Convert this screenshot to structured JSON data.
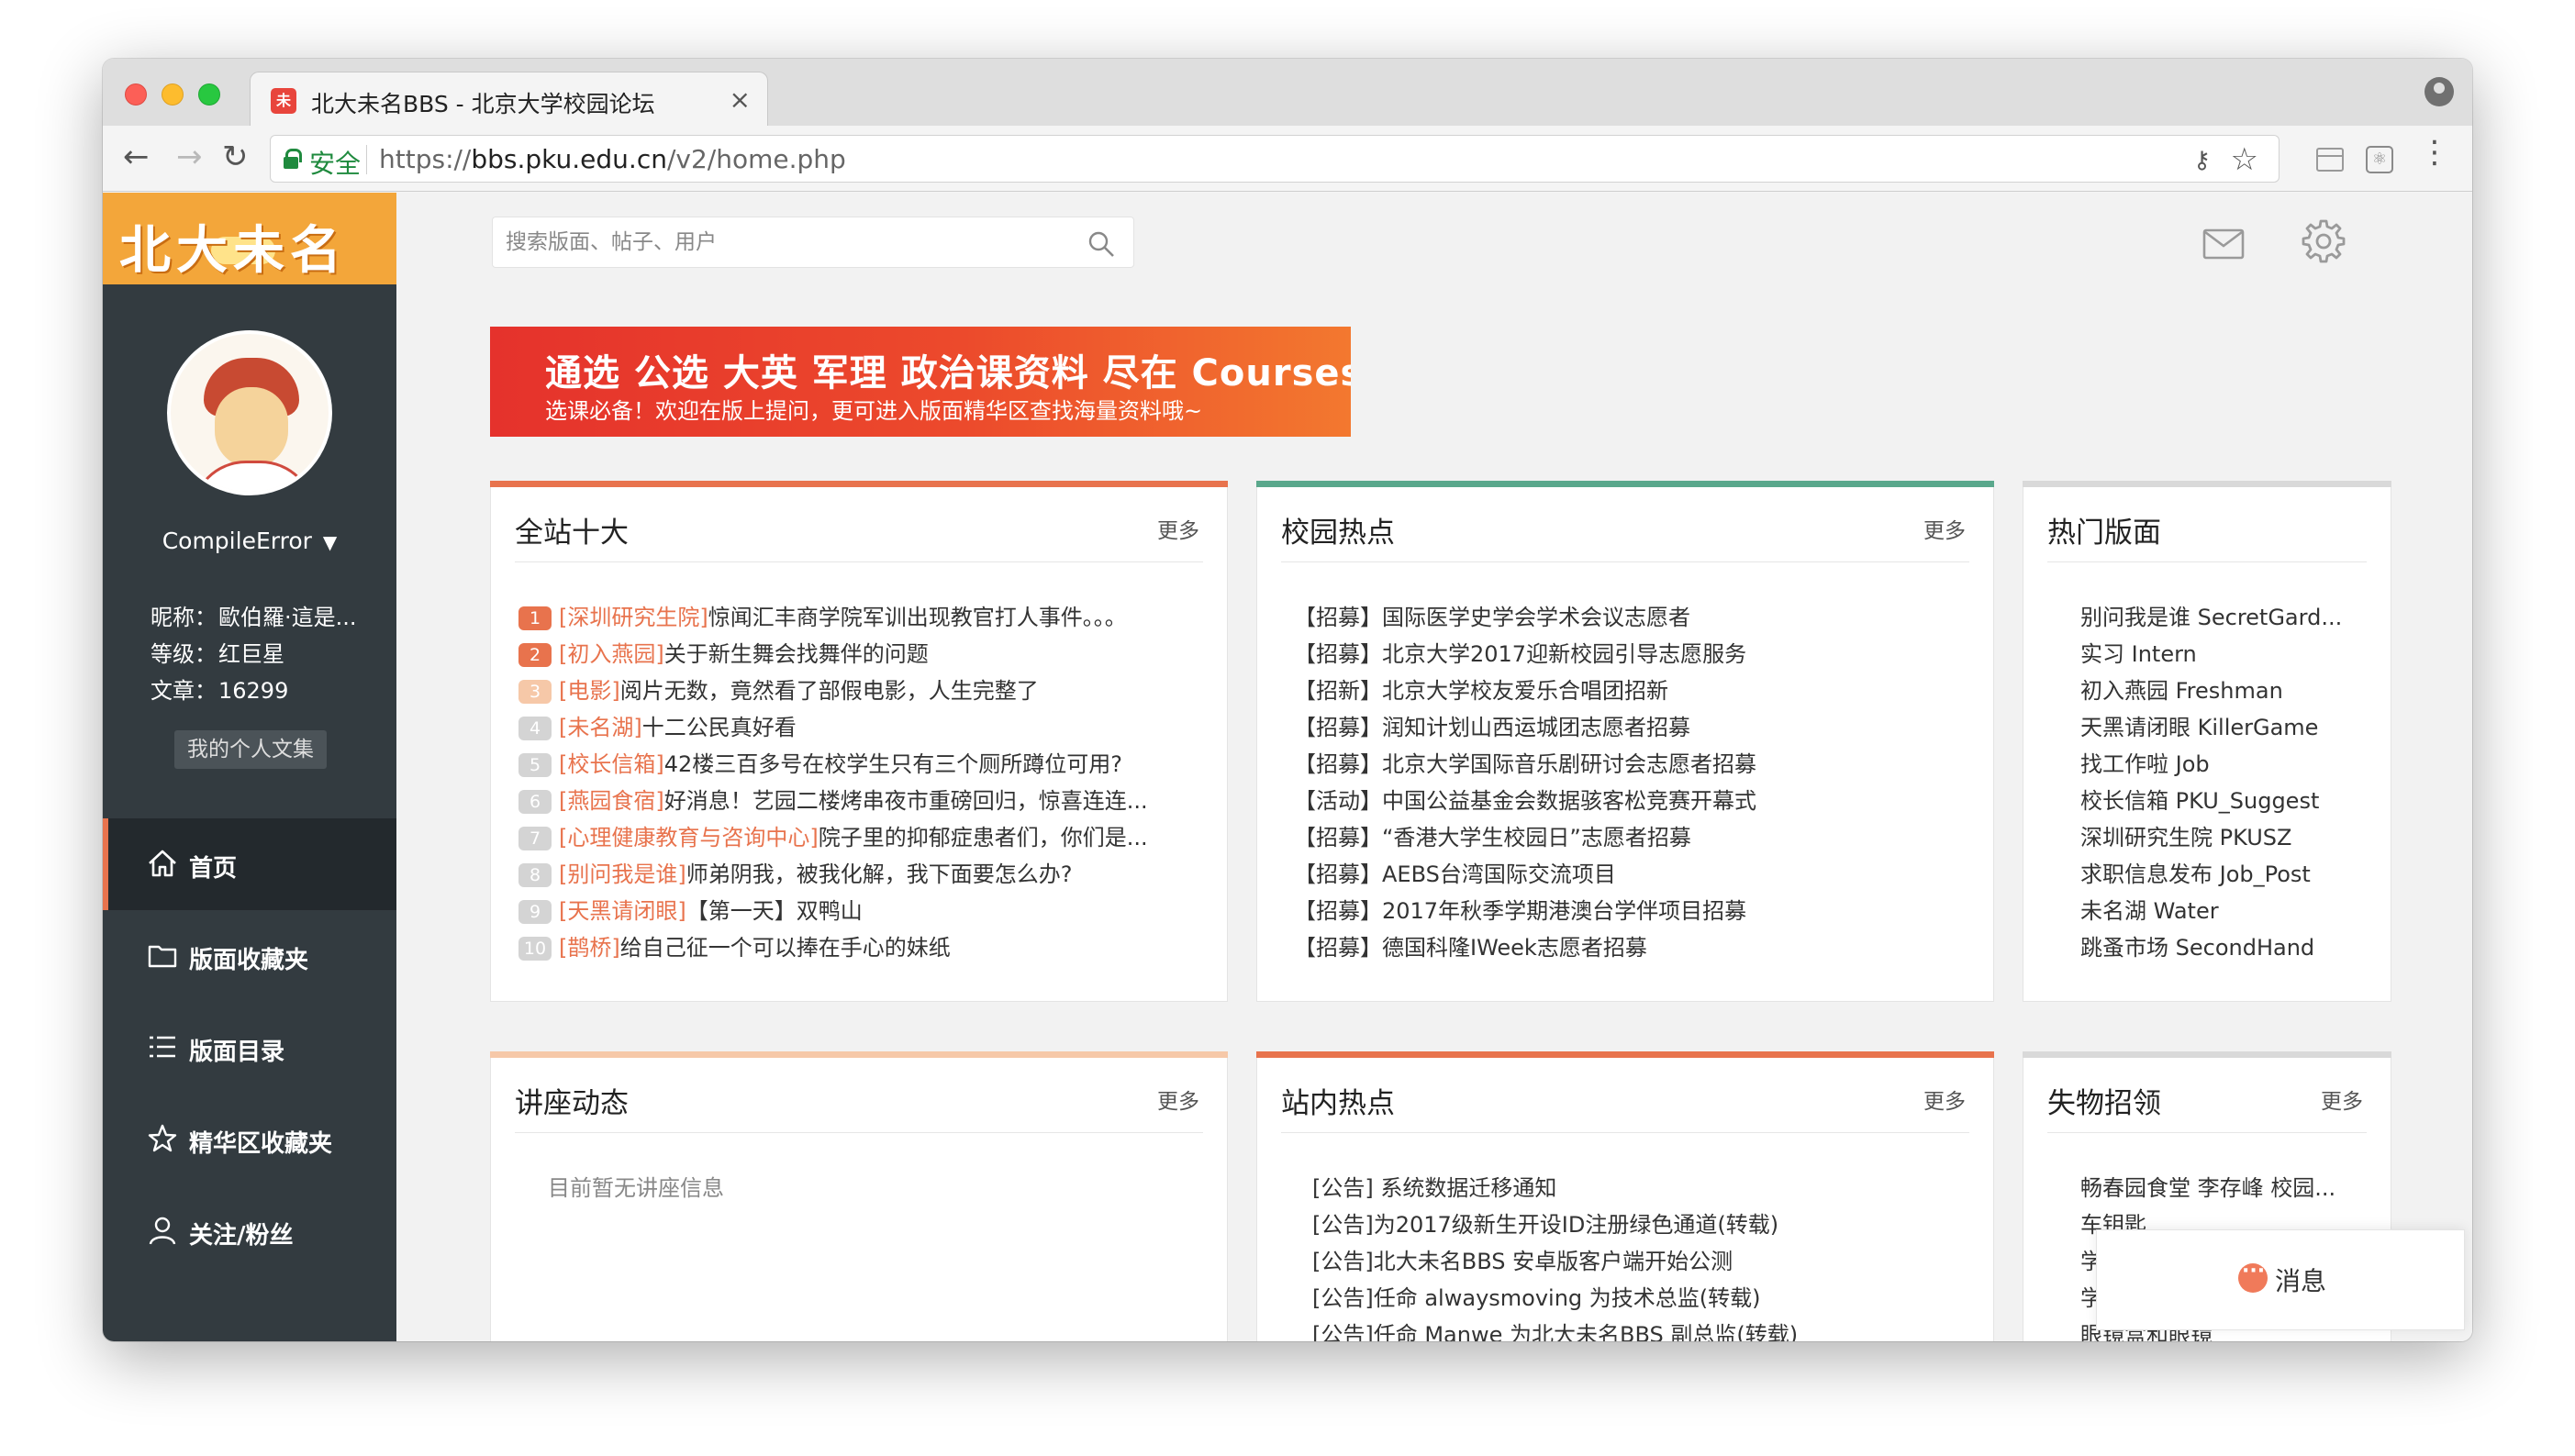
{
  "browser": {
    "tab_title": "北大未名BBS - 北京大学校园论坛",
    "tab_favicon": "未",
    "tab_close": "×",
    "secure_label": "安全",
    "url_prefix": "https://",
    "url_host": "bbs.pku.edu.cn",
    "url_path": "/v2/home.php"
  },
  "sidebar": {
    "logo": "北大未名",
    "username": "CompileError",
    "nickname_label": "昵称：",
    "nickname": "歐伯羅·這是...",
    "level_label": "等级：",
    "level": "红巨星",
    "posts_label": "文章：",
    "posts": "16299",
    "my_collection": "我的个人文集",
    "nav": [
      {
        "label": "首页",
        "icon": "home-icon"
      },
      {
        "label": "版面收藏夹",
        "icon": "folder-icon"
      },
      {
        "label": "版面目录",
        "icon": "list-icon"
      },
      {
        "label": "精华区收藏夹",
        "icon": "star-icon"
      },
      {
        "label": "关注/粉丝",
        "icon": "person-icon"
      }
    ]
  },
  "header": {
    "search_placeholder": "搜索版面、帖子、用户"
  },
  "banner": {
    "title": "通选 公选 大英 军理 政治课资料 尽在 Courses 版",
    "subtitle": "选课必备！欢迎在版上提问，更可进入版面精华区查找海量资料哦~"
  },
  "top10": {
    "title": "全站十大",
    "more": "更多",
    "color": "#e8734d",
    "items": [
      {
        "n": "1",
        "board": "[深圳研究生院]",
        "text": "惊闻汇丰商学院军训出现教官打人事件。。。"
      },
      {
        "n": "2",
        "board": "[初入燕园]",
        "text": "关于新生舞会找舞伴的问题"
      },
      {
        "n": "3",
        "board": "[电影]",
        "text": "阅片无数，竟然看了部假电影，人生完整了"
      },
      {
        "n": "4",
        "board": "[未名湖]",
        "text": "十二公民真好看"
      },
      {
        "n": "5",
        "board": "[校长信箱]",
        "text": "42楼三百多号在校学生只有三个厕所蹲位可用?"
      },
      {
        "n": "6",
        "board": "[燕园食宿]",
        "text": "好消息！艺园二楼烤串夜市重磅回归，惊喜连连..."
      },
      {
        "n": "7",
        "board": "[心理健康教育与咨询中心]",
        "text": "院子里的抑郁症患者们，你们是..."
      },
      {
        "n": "8",
        "board": "[别问我是谁]",
        "text": "师弟阴我，被我化解，我下面要怎么办?"
      },
      {
        "n": "9",
        "board": "[天黑请闭眼]",
        "text": "【第一天】双鸭山"
      },
      {
        "n": "10",
        "board": "[鹊桥]",
        "text": "给自己征一个可以捧在手心的妹纸"
      }
    ]
  },
  "campus": {
    "title": "校园热点",
    "more": "更多",
    "color": "#5aa88c",
    "items": [
      "【招募】国际医学史学会学术会议志愿者",
      "【招募】北京大学2017迎新校园引导志愿服务",
      "【招新】北京大学校友爱乐合唱团招新",
      "【招募】润知计划山西运城团志愿者招募",
      "【招募】北京大学国际音乐剧研讨会志愿者招募",
      "【活动】中国公益基金会数据骇客松竞赛开幕式",
      "【招募】“香港大学生校园日”志愿者招募",
      "【招募】AEBS台湾国际交流项目",
      "【招募】2017年秋季学期港澳台学伴项目招募",
      "【招募】德国科隆IWeek志愿者招募"
    ]
  },
  "hotboards": {
    "title": "热门版面",
    "color": "#d9d9d9",
    "items": [
      "别问我是谁 SecretGard...",
      "实习 Intern",
      "初入燕园 Freshman",
      "天黑请闭眼 KillerGame",
      "找工作啦 Job",
      "校长信箱 PKU_Suggest",
      "深圳研究生院 PKUSZ",
      "求职信息发布 Job_Post",
      "未名湖 Water",
      "跳蚤市场 SecondHand"
    ]
  },
  "lectures": {
    "title": "讲座动态",
    "more": "更多",
    "color": "#f6c8a8",
    "empty": "目前暂无讲座信息"
  },
  "sitehot": {
    "title": "站内热点",
    "more": "更多",
    "color": "#e8734d",
    "items": [
      "[公告] 系统数据迁移通知",
      "[公告]为2017级新生开设ID注册绿色通道(转载)",
      "[公告]北大未名BBS 安卓版客户端开始公测",
      "[公告]任命 alwaysmoving 为技术总监(转载)",
      "[公告]任命 Manwe 为北大未名BBS 副总监(转载)"
    ]
  },
  "lostfound": {
    "title": "失物招领",
    "more": "更多",
    "color": "#d9d9d9",
    "items": [
      "畅春园食堂 李存峰 校园...",
      "车钥匙",
      "学",
      "学",
      "眼镜盒和眼镜"
    ]
  },
  "chat": {
    "label": "消息"
  },
  "colors": {
    "sidebar_bg": "#333b40",
    "logo_bg": "#f3a63a",
    "accent": "#e8734d",
    "num_top3": "#e8734d",
    "num_rest": "#d4d4d4",
    "num_third": "#f6c8a8"
  }
}
